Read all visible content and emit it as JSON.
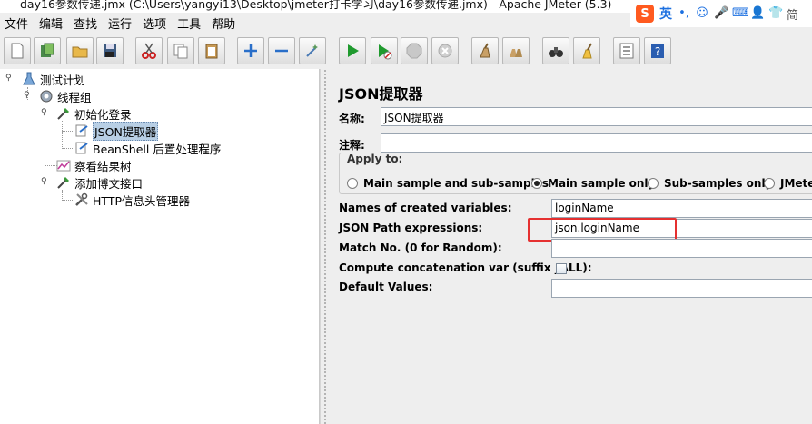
{
  "window": {
    "title": "day16参数传递.jmx (C:\\Users\\yangyi13\\Desktop\\jmeter打卡学习\\day16参数传递.jmx) - Apache JMeter (5.3)"
  },
  "ime_bar": {
    "logo": "S",
    "mode": "英",
    "punct": "•,",
    "extra": "简"
  },
  "menu": [
    "文件",
    "编辑",
    "查找",
    "运行",
    "选项",
    "工具",
    "帮助"
  ],
  "toolbar": {
    "buttons": [
      "new",
      "templates",
      "open",
      "save",
      "cut",
      "copy",
      "paste",
      "expand",
      "collapse",
      "toggle",
      "start",
      "start-no-timers",
      "stop",
      "shutdown",
      "clear",
      "clear-all",
      "search",
      "reset-search",
      "function-helper",
      "help"
    ]
  },
  "tree": {
    "nodes": [
      {
        "label": "测试计划",
        "icon": "flask-icon"
      },
      {
        "label": "线程组",
        "icon": "gear-icon"
      },
      {
        "label": "初始化登录",
        "icon": "dropper-icon"
      },
      {
        "label": "JSON提取器",
        "icon": "extractor-icon",
        "selected": true
      },
      {
        "label": "BeanShell 后置处理程序",
        "icon": "extractor-icon"
      },
      {
        "label": "察看结果树",
        "icon": "chart-icon"
      },
      {
        "label": "添加博文接口",
        "icon": "dropper-icon"
      },
      {
        "label": "HTTP信息头管理器",
        "icon": "wrench-icon"
      }
    ]
  },
  "panel": {
    "title": "JSON提取器",
    "name_label": "名称:",
    "name_value": "JSON提取器",
    "comment_label": "注释:",
    "comment_value": "",
    "apply_to": {
      "legend": "Apply to:",
      "options": [
        "Main sample and sub-samples",
        "Main sample only",
        "Sub-samples only",
        "JMete"
      ],
      "selected_index": 1
    },
    "fields": [
      {
        "label": "Names of created variables:",
        "value": "loginName"
      },
      {
        "label": "JSON Path expressions:",
        "value": "json.loginName"
      },
      {
        "label": "Match No. (0 for Random):",
        "value": ""
      },
      {
        "label": "Compute concatenation var (suffix _ALL):",
        "value": "",
        "checked": false
      },
      {
        "label": "Default Values:",
        "value": ""
      }
    ],
    "highlight_color": "#e53030"
  }
}
